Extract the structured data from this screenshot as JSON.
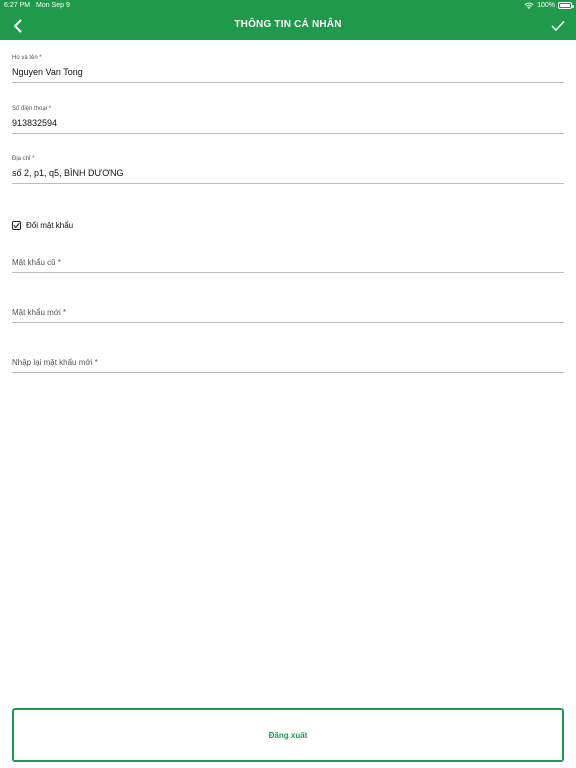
{
  "status_bar": {
    "time": "6:27 PM",
    "date": "Mon Sep 9",
    "battery": "100%"
  },
  "header": {
    "title": "THÔNG TIN CÁ NHÂN",
    "back_icon": "chevron-left-icon",
    "done_icon": "checkmark-icon",
    "color": "#1f9a4a"
  },
  "form": {
    "name": {
      "label": "Họ và tên *",
      "value": "Nguyen Van Tong"
    },
    "phone": {
      "label": "Số điện thoại *",
      "value": "913832594"
    },
    "address": {
      "label": "Địa chỉ *",
      "value": "số 2, p1, q5, BÌNH DƯƠNG"
    },
    "change_password": {
      "label": "Đổi mật khẩu",
      "checked": true
    },
    "old_password": {
      "placeholder": "Mật khẩu cũ *"
    },
    "new_password": {
      "placeholder": "Mật khẩu mới *"
    },
    "confirm_password": {
      "placeholder": "Nhập lại mật khẩu mới *"
    }
  },
  "footer": {
    "logout_label": "Đăng xuất"
  }
}
